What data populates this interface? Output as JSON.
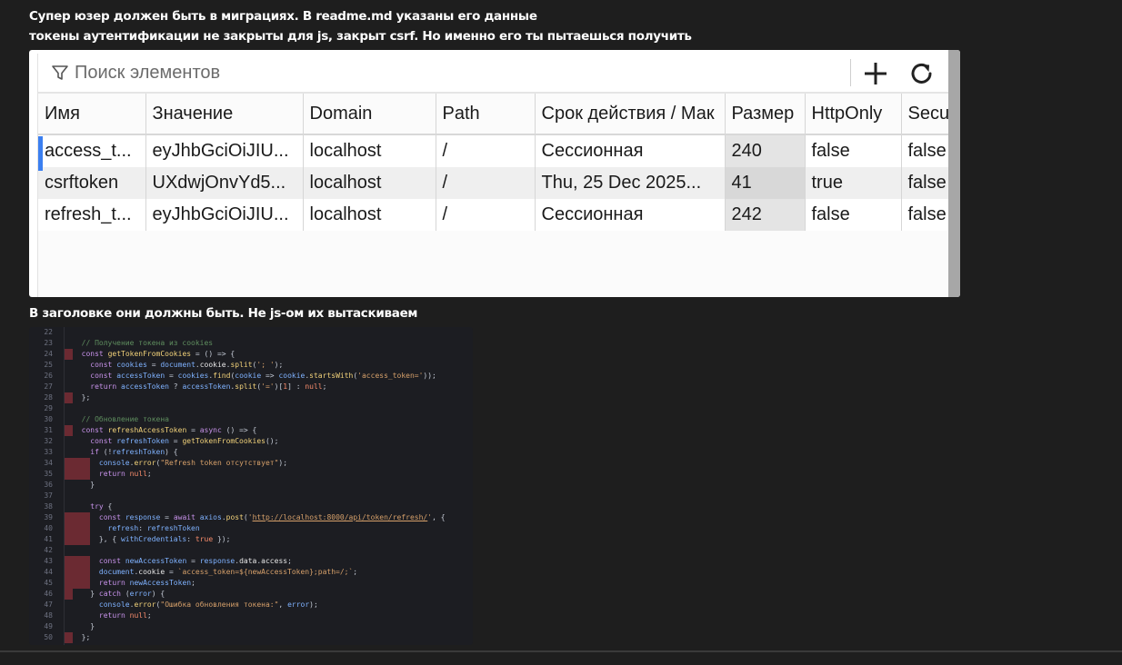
{
  "messages": {
    "line1": "Супер юзер должен быть в миграциях. В readme.md указаны его данные",
    "line2": "токены аутентификации не закрыты для js, закрыт csrf. Но именно его ты пытаешься получить",
    "line3": "В заголовке они должны быть. Не js-ом их вытаскиваем"
  },
  "cookie_panel": {
    "search_placeholder": "Поиск элементов",
    "toolbar_icons": [
      "filter-icon",
      "add-icon",
      "refresh-icon"
    ],
    "columns": [
      "Имя",
      "Значение",
      "Domain",
      "Path",
      "Срок действия / Мак",
      "Размер",
      "HttpOnly",
      "Secu"
    ],
    "rows": [
      {
        "name": "access_t...",
        "value": "eyJhbGciOiJIU...",
        "domain": "localhost",
        "path": "/",
        "expires": "Сессионная",
        "size": "240",
        "httponly": "false",
        "secure": "false"
      },
      {
        "name": "csrftoken",
        "value": "UXdwjOnvYd5...",
        "domain": "localhost",
        "path": "/",
        "expires": "Thu, 25 Dec 2025...",
        "size": "41",
        "httponly": "true",
        "secure": "false"
      },
      {
        "name": "refresh_t...",
        "value": "eyJhbGciOiJIU...",
        "domain": "localhost",
        "path": "/",
        "expires": "Сессионная",
        "size": "242",
        "httponly": "false",
        "secure": "false"
      }
    ],
    "colors": {
      "selection": "#3b7ff0",
      "header_bg": "#fbfbfb",
      "alt_row": "#efefef"
    }
  },
  "code": {
    "lines": [
      {
        "n": "22",
        "t": ""
      },
      {
        "n": "23",
        "t": "  // Получение токена из cookies"
      },
      {
        "n": "24",
        "t": "  const getTokenFromCookies = () => {"
      },
      {
        "n": "25",
        "t": "    const cookies = document.cookie.split('; ');"
      },
      {
        "n": "26",
        "t": "    const accessToken = cookies.find(cookie => cookie.startsWith('access_token='));"
      },
      {
        "n": "27",
        "t": "    return accessToken ? accessToken.split('=')[1] : null;"
      },
      {
        "n": "28",
        "t": "  };"
      },
      {
        "n": "29",
        "t": ""
      },
      {
        "n": "30",
        "t": "  // Обновление токена"
      },
      {
        "n": "31",
        "t": "  const refreshAccessToken = async () => {"
      },
      {
        "n": "32",
        "t": "    const refreshToken = getTokenFromCookies();"
      },
      {
        "n": "33",
        "t": "    if (!refreshToken) {"
      },
      {
        "n": "34",
        "t": "      console.error(\"Refresh token отсутствует\");"
      },
      {
        "n": "35",
        "t": "      return null;"
      },
      {
        "n": "36",
        "t": "    }"
      },
      {
        "n": "37",
        "t": ""
      },
      {
        "n": "38",
        "t": "    try {"
      },
      {
        "n": "39",
        "t": "      const response = await axios.post('http://localhost:8000/api/token/refresh/', {"
      },
      {
        "n": "40",
        "t": "        refresh: refreshToken"
      },
      {
        "n": "41",
        "t": "      }, { withCredentials: true });"
      },
      {
        "n": "42",
        "t": ""
      },
      {
        "n": "43",
        "t": "      const newAccessToken = response.data.access;"
      },
      {
        "n": "44",
        "t": "      document.cookie = `access_token=${newAccessToken};path=/;`;"
      },
      {
        "n": "45",
        "t": "      return newAccessToken;"
      },
      {
        "n": "46",
        "t": "    } catch (error) {"
      },
      {
        "n": "47",
        "t": "      console.error(\"Ошибка обновления токена:\", error);"
      },
      {
        "n": "48",
        "t": "      return null;"
      },
      {
        "n": "49",
        "t": "    }"
      },
      {
        "n": "50",
        "t": "  };"
      }
    ],
    "colors": {
      "background": "#1c1d22",
      "marker": "#6b2a32",
      "comment": "#5f8e5f",
      "keyword": "#c792ea",
      "function": "#f2d27a",
      "string": "#d6a06a"
    }
  }
}
